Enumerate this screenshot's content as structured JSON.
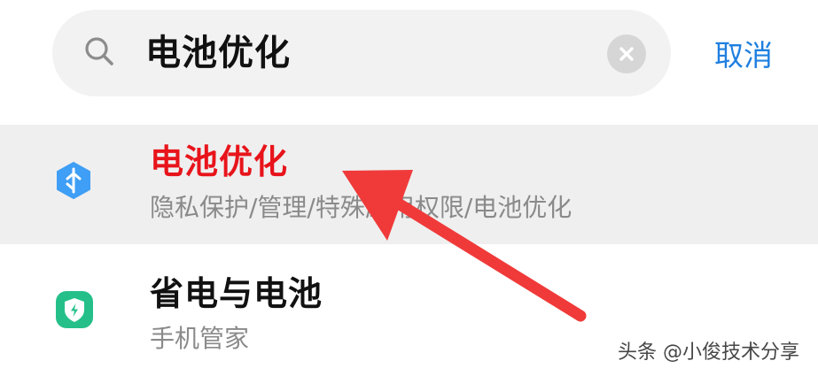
{
  "search": {
    "query": "电池优化",
    "icon": "search-icon",
    "clear_icon": "close-icon",
    "cancel_label": "取消"
  },
  "results": [
    {
      "title": "电池优化",
      "subtitle": "隐私保护/管理/特殊应用权限/电池优化",
      "icon": "battery-settings-icon",
      "title_color": "#e8141b",
      "highlighted": true
    },
    {
      "title": "省电与电池",
      "subtitle": "手机管家",
      "icon": "phone-manager-shield-icon",
      "title_color": "#111111",
      "highlighted": false
    }
  ],
  "annotation": {
    "type": "red-arrow",
    "color": "#f03a3a"
  },
  "watermark": "头条 @小俊技术分享",
  "colors": {
    "accent": "#1f7fe0",
    "highlight_bg": "#efefef",
    "result1_icon": "#3f9ef5",
    "result2_icon": "#25c08a"
  }
}
